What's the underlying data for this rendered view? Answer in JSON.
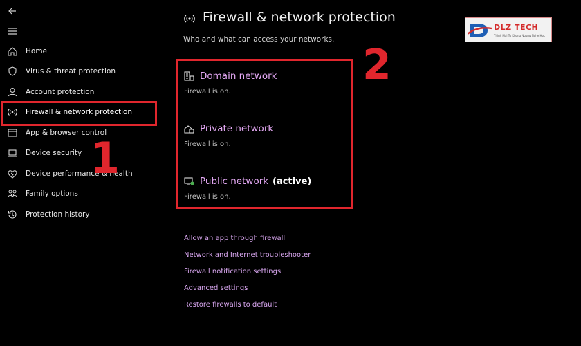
{
  "window": {
    "back_icon": "back-arrow-icon",
    "menu_icon": "hamburger-menu-icon"
  },
  "sidebar": {
    "items": [
      {
        "label": "Home",
        "icon": "home-icon"
      },
      {
        "label": "Virus & threat protection",
        "icon": "shield-icon"
      },
      {
        "label": "Account protection",
        "icon": "person-icon"
      },
      {
        "label": "Firewall & network protection",
        "icon": "antenna-icon",
        "selected": true
      },
      {
        "label": "App & browser control",
        "icon": "browser-window-icon"
      },
      {
        "label": "Device security",
        "icon": "laptop-icon"
      },
      {
        "label": "Device performance & health",
        "icon": "heart-pulse-icon"
      },
      {
        "label": "Family options",
        "icon": "family-icon"
      },
      {
        "label": "Protection history",
        "icon": "history-clock-icon"
      }
    ]
  },
  "annotations": {
    "step1": "1",
    "step2": "2",
    "highlight_color": "#e0262d"
  },
  "main": {
    "title": "Firewall & network protection",
    "subtitle": "Who and what can access your networks.",
    "networks": [
      {
        "name": "Domain network",
        "status": "Firewall is on.",
        "icon": "domain-network-icon"
      },
      {
        "name": "Private network",
        "status": "Firewall is on.",
        "icon": "private-network-icon"
      },
      {
        "name": "Public network",
        "active_label": "(active)",
        "status": "Firewall is on.",
        "icon": "public-network-icon"
      }
    ],
    "links": [
      "Allow an app through firewall",
      "Network and Internet troubleshooter",
      "Firewall notification settings",
      "Advanced settings",
      "Restore firewalls to default"
    ],
    "link_color": "#d8a6ef"
  },
  "logo": {
    "text": "DLZ TECH",
    "tagline": "Thinh Mai Tu Khong Ngung Nghe Hoc"
  }
}
